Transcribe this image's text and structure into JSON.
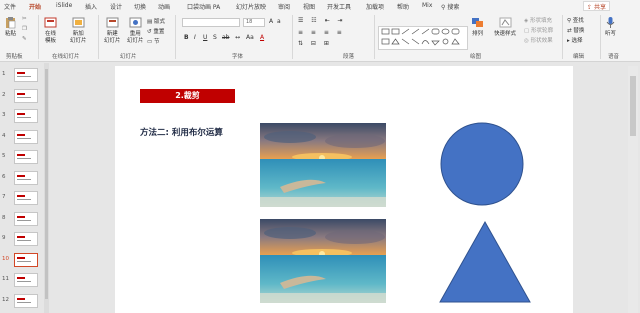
{
  "menu": {
    "tabs": [
      "文件",
      "开始",
      "iSlide",
      "插入",
      "设计",
      "切换",
      "动画",
      "口袋动画 PA",
      "幻灯片放映",
      "审阅",
      "视图",
      "开发工具",
      "加载项",
      "帮助",
      "Mix"
    ],
    "search": "搜索",
    "share": "共享"
  },
  "ribbon": {
    "clipboard": {
      "paste": "粘贴",
      "label": "剪贴板"
    },
    "online": {
      "online_btn": "在线\n模板",
      "new_btn": "新加\n幻灯片",
      "label": "在线幻灯片"
    },
    "slides": {
      "new_slide": "新建\n幻灯片",
      "reuse": "重用\n幻灯片",
      "layout": "版式",
      "reset": "重置",
      "section": "节",
      "label": "幻灯片"
    },
    "font": {
      "size": "18",
      "label": "字体"
    },
    "paragraph": {
      "label": "段落"
    },
    "drawing": {
      "arrange": "排列",
      "quick_styles": "快速样式",
      "fill": "形状填充",
      "outline": "形状轮廓",
      "effects": "形状效果",
      "label": "绘图"
    },
    "editing": {
      "find": "查找",
      "replace": "替换",
      "select": "选择",
      "label": "编辑"
    },
    "voice": {
      "dictate": "听写",
      "label": "语音"
    }
  },
  "thumbnails": [
    "1",
    "2",
    "3",
    "4",
    "5",
    "6",
    "7",
    "8",
    "9",
    "10",
    "11",
    "12"
  ],
  "selected_slide": "10",
  "slide": {
    "title": "2.裁剪",
    "method": "方法二: 利用布尔运算"
  },
  "colors": {
    "accent": "#b7472a",
    "title_bg": "#c00000",
    "shape_fill": "#4472c4"
  }
}
